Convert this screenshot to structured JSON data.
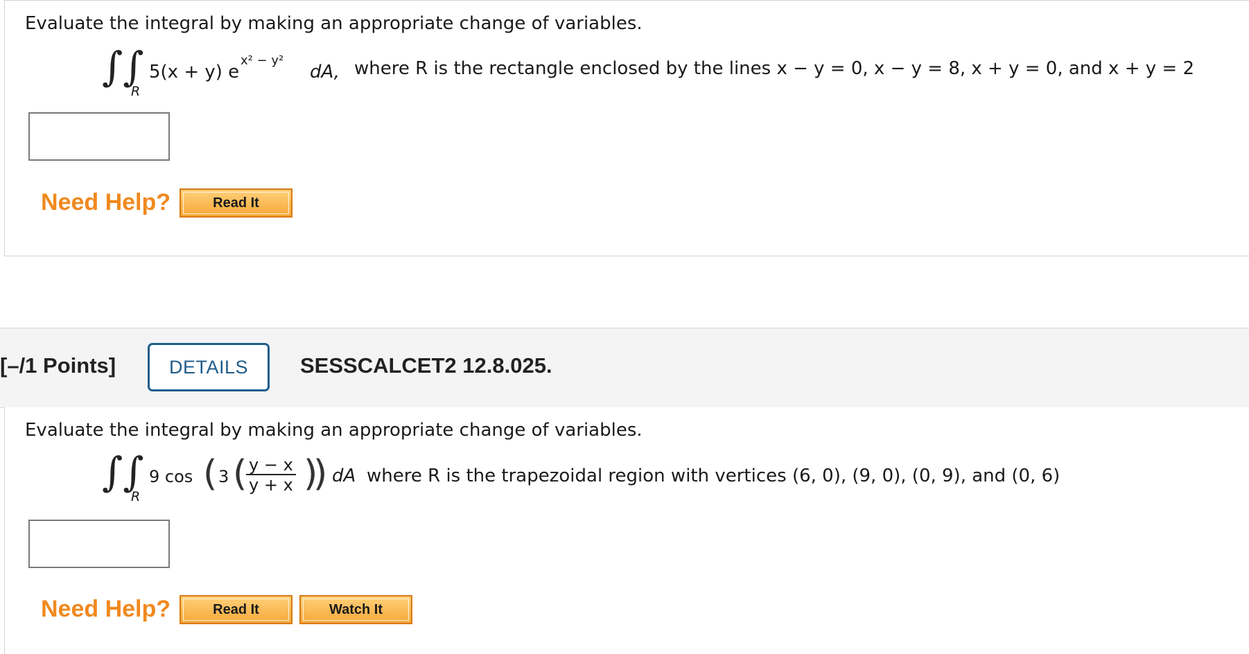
{
  "q1": {
    "prompt": "Evaluate the integral by making an appropriate change of variables.",
    "integral_symbol": "∫∫",
    "region": "R",
    "integrand_base": "5(x + y) e",
    "exponent": "x² − y²",
    "differential": "dA,",
    "condition": "where R is the rectangle enclosed by the lines  x − y = 0,  x − y = 8,  x + y = 0,  and  x + y = 2",
    "need_help": "Need Help?",
    "read_it": "Read It"
  },
  "q2_header": {
    "points": "[–/1 Points]",
    "details": "DETAILS",
    "question_id": "SESSCALCET2 12.8.025."
  },
  "q2": {
    "prompt": "Evaluate the integral by making an appropriate change of variables.",
    "integral_symbol": "∫∫",
    "region": "R",
    "coef": "9 cos",
    "inner_coef": "3",
    "frac_num": "y − x",
    "frac_den": "y + x",
    "differential": "dA",
    "condition": "where R is the trapezoidal region with vertices (6, 0), (9, 0), (0, 9), and (0, 6)",
    "need_help": "Need Help?",
    "read_it": "Read It",
    "watch_it": "Watch It"
  }
}
